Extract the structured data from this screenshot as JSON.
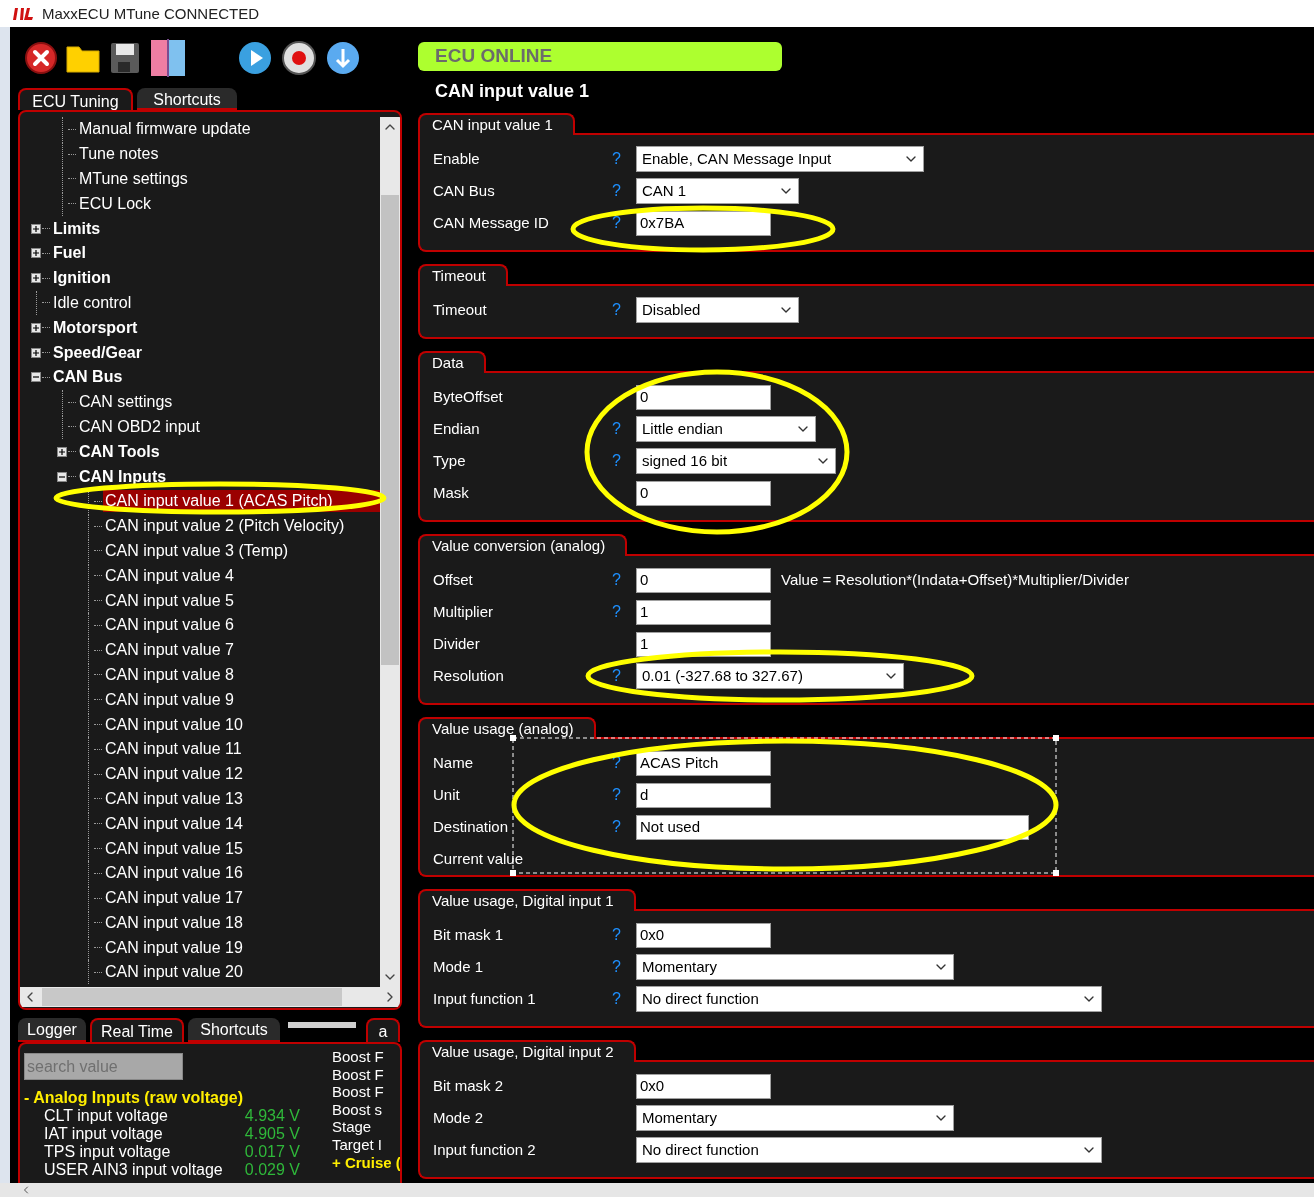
{
  "window": {
    "title": "MaxxECU MTune CONNECTED"
  },
  "tree_tabs": [
    {
      "label": "ECU Tuning",
      "selected": true
    },
    {
      "label": "Shortcuts",
      "selected": false
    }
  ],
  "tree": [
    {
      "children": [
        {
          "label": "Manual firmware update",
          "kind": "leaf",
          "selected": false
        },
        {
          "label": "Tune notes",
          "kind": "leaf",
          "selected": false
        },
        {
          "label": "MTune settings",
          "kind": "leaf",
          "selected": false
        },
        {
          "label": "ECU Lock",
          "kind": "leaf",
          "selected": false
        }
      ]
    },
    {
      "label": "Limits",
      "kind": "group",
      "expanded": false,
      "selected": false
    },
    {
      "label": "Fuel",
      "kind": "group",
      "expanded": false,
      "selected": false
    },
    {
      "label": "Ignition",
      "kind": "group",
      "expanded": false,
      "selected": false
    },
    {
      "label": "Idle control",
      "kind": "leaf",
      "selected": false
    },
    {
      "label": "Motorsport",
      "kind": "group",
      "expanded": false,
      "selected": false
    },
    {
      "label": "Speed/Gear",
      "kind": "group",
      "expanded": false,
      "selected": false
    },
    {
      "label": "CAN Bus",
      "kind": "group",
      "expanded": true,
      "selected": false,
      "children": [
        {
          "label": "CAN settings",
          "kind": "leaf",
          "selected": false
        },
        {
          "label": "CAN OBD2 input",
          "kind": "leaf",
          "selected": false
        },
        {
          "label": "CAN Tools",
          "kind": "group",
          "expanded": false,
          "selected": false
        },
        {
          "label": "CAN Inputs",
          "kind": "group",
          "expanded": true,
          "selected": false,
          "children": [
            {
              "label": "CAN input value 1 (ACAS Pitch)",
              "kind": "leaf",
              "selected": true
            },
            {
              "label": "CAN input value 2 (Pitch Velocity)",
              "kind": "leaf",
              "selected": false
            },
            {
              "label": "CAN input value 3 (Temp)",
              "kind": "leaf",
              "selected": false
            },
            {
              "label": "CAN input value 4",
              "kind": "leaf",
              "selected": false
            },
            {
              "label": "CAN input value 5",
              "kind": "leaf",
              "selected": false
            },
            {
              "label": "CAN input value 6",
              "kind": "leaf",
              "selected": false
            },
            {
              "label": "CAN input value 7",
              "kind": "leaf",
              "selected": false
            },
            {
              "label": "CAN input value 8",
              "kind": "leaf",
              "selected": false
            },
            {
              "label": "CAN input value 9",
              "kind": "leaf",
              "selected": false
            },
            {
              "label": "CAN input value 10",
              "kind": "leaf",
              "selected": false
            },
            {
              "label": "CAN input value 11",
              "kind": "leaf",
              "selected": false
            },
            {
              "label": "CAN input value 12",
              "kind": "leaf",
              "selected": false
            },
            {
              "label": "CAN input value 13",
              "kind": "leaf",
              "selected": false
            },
            {
              "label": "CAN input value 14",
              "kind": "leaf",
              "selected": false
            },
            {
              "label": "CAN input value 15",
              "kind": "leaf",
              "selected": false
            },
            {
              "label": "CAN input value 16",
              "kind": "leaf",
              "selected": false
            },
            {
              "label": "CAN input value 17",
              "kind": "leaf",
              "selected": false
            },
            {
              "label": "CAN input value 18",
              "kind": "leaf",
              "selected": false
            },
            {
              "label": "CAN input value 19",
              "kind": "leaf",
              "selected": false
            },
            {
              "label": "CAN input value 20",
              "kind": "leaf",
              "selected": false
            }
          ]
        }
      ]
    }
  ],
  "bottom_tabs": [
    {
      "label": "Logger",
      "selected": false
    },
    {
      "label": "Real Time",
      "selected": true
    },
    {
      "label": "Shortcuts",
      "selected": false
    },
    {
      "label": "a",
      "selected": true
    }
  ],
  "realtime": {
    "search": {
      "placeholder": "search value"
    },
    "rows": [
      {
        "kind": "section",
        "name": "- Analog Inputs (raw voltage)"
      },
      {
        "kind": "value",
        "name": "CLT input voltage",
        "value": "4.934 V"
      },
      {
        "kind": "value",
        "name": "IAT input voltage",
        "value": "4.905 V"
      },
      {
        "kind": "value",
        "name": "TPS input voltage",
        "value": "0.017 V"
      },
      {
        "kind": "value",
        "name": "USER AIN3 input voltage",
        "value": "0.029 V"
      }
    ],
    "side_list": [
      {
        "kind": "item",
        "label": "Boost F"
      },
      {
        "kind": "item",
        "label": "Boost F"
      },
      {
        "kind": "item",
        "label": "Boost F"
      },
      {
        "kind": "item",
        "label": "Boost s"
      },
      {
        "kind": "item",
        "label": "Stage"
      },
      {
        "kind": "item",
        "label": "Target I"
      },
      {
        "kind": "section",
        "label": "+ Cruise ("
      }
    ]
  },
  "status": {
    "label": "ECU ONLINE"
  },
  "page_title": "CAN input value 1",
  "groups": [
    {
      "title": "CAN input value 1",
      "rows": [
        {
          "label": "Enable",
          "help": "?",
          "kind": "select",
          "value": "Enable, CAN Message Input"
        },
        {
          "label": "CAN Bus",
          "help": "?",
          "kind": "select",
          "value": "CAN 1"
        },
        {
          "label": "CAN Message ID",
          "help": "?",
          "kind": "text",
          "value": "0x7BA"
        }
      ]
    },
    {
      "title": "Timeout",
      "rows": [
        {
          "label": "Timeout",
          "help": "?",
          "kind": "select",
          "value": "Disabled"
        }
      ]
    },
    {
      "title": "Data",
      "rows": [
        {
          "label": "ByteOffset",
          "kind": "text",
          "value": "0"
        },
        {
          "label": "Endian",
          "help": "?",
          "kind": "select",
          "value": "Little endian"
        },
        {
          "label": "Type",
          "help": "?",
          "kind": "select",
          "value": "signed 16 bit"
        },
        {
          "label": "Mask",
          "kind": "text",
          "value": "0"
        }
      ]
    },
    {
      "title": "Value conversion (analog)",
      "rows": [
        {
          "label": "Offset",
          "help": "?",
          "kind": "text",
          "value": "0",
          "note": "Value = Resolution*(Indata+Offset)*Multiplier/Divider"
        },
        {
          "label": "Multiplier",
          "help": "?",
          "kind": "text",
          "value": "1"
        },
        {
          "label": "Divider",
          "kind": "text",
          "value": "1"
        },
        {
          "label": "Resolution",
          "help": "?",
          "kind": "select",
          "value": "0.01 (-327.68 to 327.67)"
        }
      ]
    },
    {
      "title": "Value usage (analog)",
      "rows": [
        {
          "label": "Name",
          "help": "?",
          "kind": "text",
          "value": "ACAS Pitch"
        },
        {
          "label": "Unit",
          "help": "?",
          "kind": "text",
          "value": "d"
        },
        {
          "label": "Destination",
          "help": "?",
          "kind": "text",
          "value": "Not used"
        },
        {
          "label": "Current value",
          "kind": "readout"
        }
      ]
    },
    {
      "title": "Value usage, Digital input 1",
      "rows": [
        {
          "label": "Bit mask 1",
          "help": "?",
          "kind": "text",
          "value": "0x0"
        },
        {
          "label": "Mode 1",
          "help": "?",
          "kind": "select",
          "value": "Momentary"
        },
        {
          "label": "Input function 1",
          "help": "?",
          "kind": "select",
          "value": "No direct function"
        }
      ]
    },
    {
      "title": "Value usage, Digital input 2",
      "rows": [
        {
          "label": "Bit mask 2",
          "kind": "text",
          "value": "0x0"
        },
        {
          "label": "Mode 2",
          "kind": "select",
          "value": "Momentary"
        },
        {
          "label": "Input function 2",
          "kind": "select",
          "value": "No direct function"
        }
      ]
    }
  ]
}
